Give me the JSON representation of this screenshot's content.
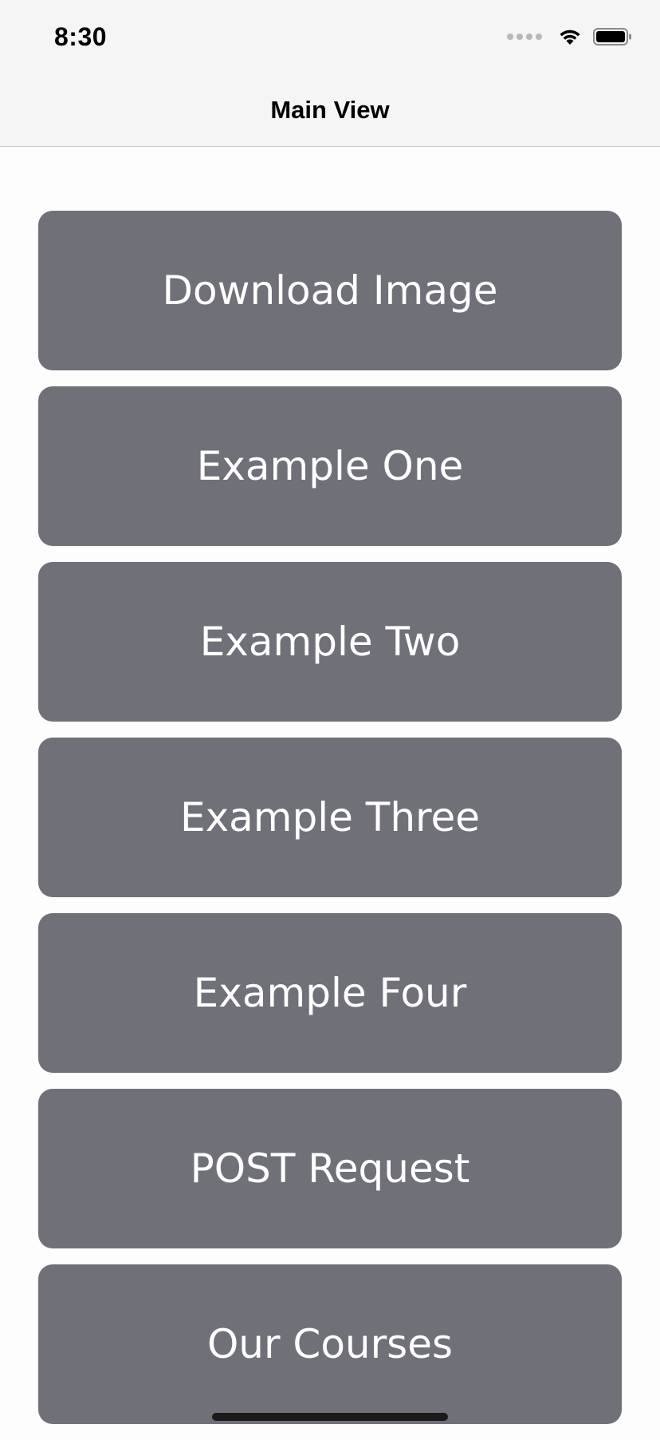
{
  "status_bar": {
    "time": "8:30"
  },
  "nav_bar": {
    "title": "Main View"
  },
  "buttons": [
    {
      "label": "Download Image"
    },
    {
      "label": "Example One"
    },
    {
      "label": "Example Two"
    },
    {
      "label": "Example Three"
    },
    {
      "label": "Example Four"
    },
    {
      "label": "POST Request"
    },
    {
      "label": "Our Courses"
    }
  ],
  "colors": {
    "button_bg": "#6f7078",
    "button_text": "#ffffff",
    "nav_bg": "#f5f5f5",
    "page_bg": "#fdfdfd"
  },
  "icons": {
    "signal": "cellular-signal-icon",
    "wifi": "wifi-icon",
    "battery": "battery-icon"
  }
}
